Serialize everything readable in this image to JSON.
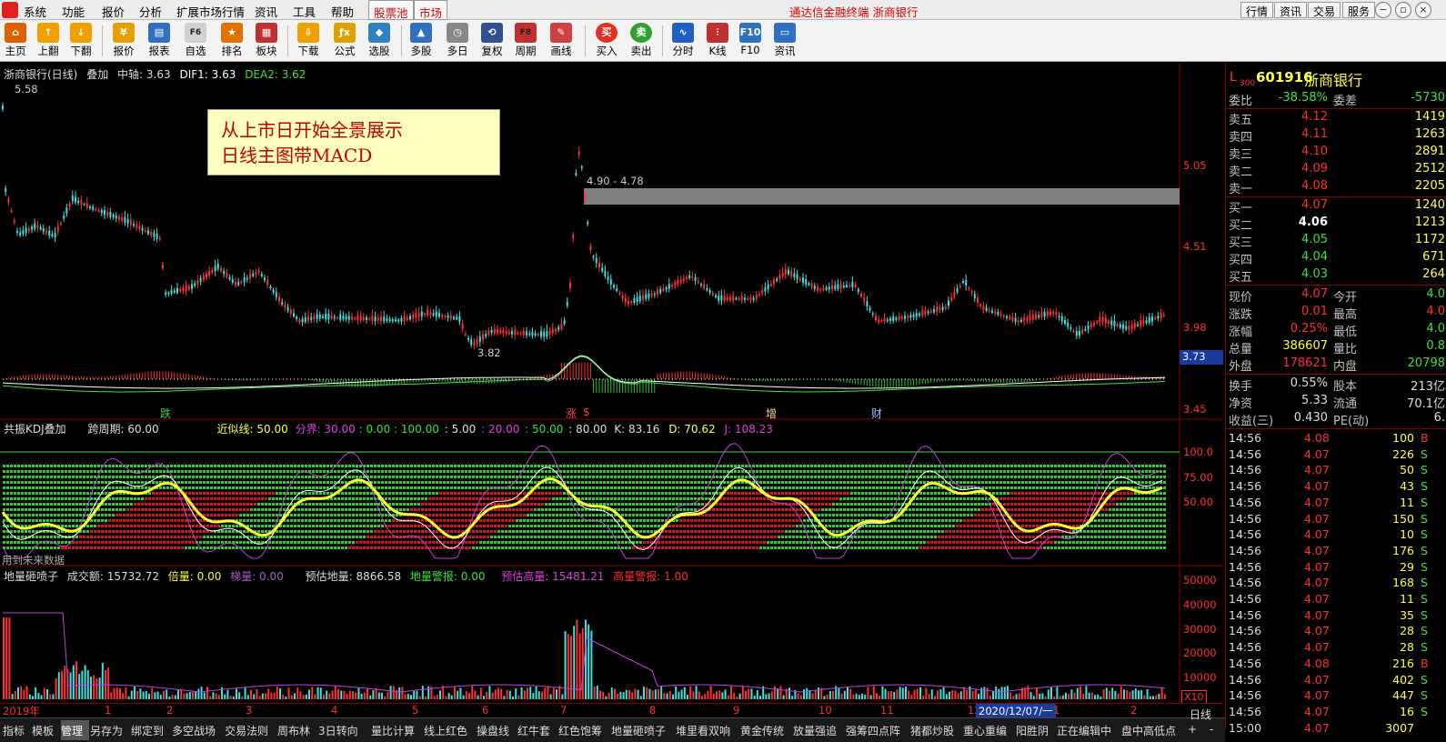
{
  "menubar": {
    "items": [
      "系统",
      "功能",
      "报价",
      "分析",
      "扩展市场行情",
      "资讯",
      "工具",
      "帮助"
    ],
    "tabs": [
      "股票池",
      "市场"
    ],
    "app_title": "通达信金融终端  浙商银行",
    "right_buttons": [
      "行情",
      "资讯",
      "交易",
      "服务"
    ]
  },
  "toolbar": {
    "buttons": [
      {
        "label": "主页",
        "icon": "home-icon",
        "color": "#e06000"
      },
      {
        "label": "上翻",
        "icon": "arrow-up-icon",
        "color": "#f0a000"
      },
      {
        "label": "下翻",
        "icon": "arrow-down-icon",
        "color": "#f0a000"
      },
      {
        "label": "报价",
        "icon": "yen-icon",
        "color": "#e8a000"
      },
      {
        "label": "报表",
        "icon": "report-icon",
        "color": "#3070c0"
      },
      {
        "label": "自选",
        "icon": "f6-icon",
        "color": "#d0d0d0"
      },
      {
        "label": "排名",
        "icon": "rank-icon",
        "color": "#e07000"
      },
      {
        "label": "板块",
        "icon": "blocks-icon",
        "color": "#c03030"
      },
      {
        "label": "下载",
        "icon": "download-icon",
        "color": "#f0a000"
      },
      {
        "label": "公式",
        "icon": "formula-icon",
        "color": "#e0a000"
      },
      {
        "label": "选股",
        "icon": "select-stock-icon",
        "color": "#3080c0"
      },
      {
        "label": "多股",
        "icon": "multi-stock-icon",
        "color": "#3070c0"
      },
      {
        "label": "多日",
        "icon": "clock-icon",
        "color": "#888888"
      },
      {
        "label": "复权",
        "icon": "restore-icon",
        "color": "#305090"
      },
      {
        "label": "周期",
        "icon": "f8-icon",
        "color": "#c03030"
      },
      {
        "label": "画线",
        "icon": "draw-line-icon",
        "color": "#d04040"
      },
      {
        "label": "买入",
        "icon": "buy-icon",
        "color": "#e03020"
      },
      {
        "label": "卖出",
        "icon": "sell-icon",
        "color": "#30a030"
      },
      {
        "label": "分时",
        "icon": "intraday-icon",
        "color": "#2060c0"
      },
      {
        "label": "K线",
        "icon": "kline-icon",
        "color": "#c03030"
      },
      {
        "label": "F10",
        "icon": "f10-icon",
        "color": "#3070c0"
      },
      {
        "label": "资讯",
        "icon": "news-icon",
        "color": "#3070c0"
      }
    ]
  },
  "main_pane": {
    "info": {
      "name": "浙商银行(日线)",
      "overlay": "叠加",
      "mid": "中轴: 3.63",
      "dif": "DIF1: 3.63",
      "dea": "DEA2: 3.62"
    },
    "high_label": "5.58",
    "low_label": "3.82",
    "zone_label": "4.90 - 4.78",
    "overlay_text": [
      "从上市日开始全景展示",
      "日线主图带MACD"
    ],
    "axis": [
      "5.05",
      "4.51",
      "3.98",
      "3.45"
    ],
    "current_price_tag": "3.73",
    "markers": [
      {
        "text": "跌",
        "color": "#40d040"
      },
      {
        "text": "涨",
        "color": "#ff4040"
      },
      {
        "text": "$",
        "color": "#ff4040"
      },
      {
        "text": "增",
        "color": "#ffd0a0"
      },
      {
        "text": "财",
        "color": "#a0c0ff"
      }
    ],
    "colors": {
      "up": "#ff3030",
      "down": "#40e0e0",
      "macd_up": "#ff3030",
      "macd_down": "#30c030"
    }
  },
  "kdj_pane": {
    "info": {
      "name": "共振KDJ叠加",
      "period": "跨周期: 60.00",
      "near": "近似线: 50.00",
      "boundary": "分界: 30.00",
      "v1": ": 0.00",
      "v2": ": 100.00",
      "v3": ": 5.00",
      "v4": ": 20.00",
      "v5": ": 50.00",
      "v6": ": 80.00",
      "k": "K: 83.16",
      "d": "D: 70.62",
      "j": "J: 108.23"
    },
    "axis": [
      "100.0",
      "75.00",
      "50.00"
    ],
    "future_note": "用到未来数据"
  },
  "volume_pane": {
    "info": {
      "name": "地量砸喷子",
      "turnover": "成交额: 15732.72",
      "times": "倍量: 0.00",
      "ladder": "梯量: 0.00",
      "est_low": "预估地量: 8866.58",
      "low_alarm": "地量警报: 0.00",
      "est_high": "预估高量: 15481.21",
      "high_alarm": "高量警报: 1.00"
    },
    "axis": [
      "50000",
      "40000",
      "30000",
      "20000",
      "10000"
    ],
    "unit_tag": "X10"
  },
  "datebar": {
    "labels": [
      "2019年",
      "1",
      "2",
      "3",
      "4",
      "5",
      "6",
      "7",
      "8",
      "9",
      "10",
      "11",
      "12",
      "2020/12/07/一",
      "1",
      "2"
    ]
  },
  "quote": {
    "code": "601916",
    "name": "浙商银行",
    "prefix": "L",
    "sub": "300",
    "weibi_label": "委比",
    "weibi": "-38.58%",
    "weicha_label": "委差",
    "weicha": "-5730",
    "asks": [
      {
        "label": "卖五",
        "price": "4.12",
        "vol": "1419"
      },
      {
        "label": "卖四",
        "price": "4.11",
        "vol": "1263"
      },
      {
        "label": "卖三",
        "price": "4.10",
        "vol": "2891"
      },
      {
        "label": "卖二",
        "price": "4.09",
        "vol": "2512"
      },
      {
        "label": "卖一",
        "price": "4.08",
        "vol": "2205"
      }
    ],
    "bids": [
      {
        "label": "买一",
        "price": "4.07",
        "vol": "1240"
      },
      {
        "label": "买二",
        "price": "4.06",
        "vol": "1213"
      },
      {
        "label": "买三",
        "price": "4.05",
        "vol": "1172"
      },
      {
        "label": "买四",
        "price": "4.04",
        "vol": "671"
      },
      {
        "label": "买五",
        "price": "4.03",
        "vol": "264"
      }
    ],
    "stats": [
      {
        "l1": "现价",
        "v1": "4.07",
        "c1": "#ff3030",
        "l2": "今开",
        "v2": "4.0",
        "c2": "#40e040"
      },
      {
        "l1": "涨跌",
        "v1": "0.01",
        "c1": "#ff3030",
        "l2": "最高",
        "v2": "4.0",
        "c2": "#ff3030"
      },
      {
        "l1": "涨幅",
        "v1": "0.25%",
        "c1": "#ff3030",
        "l2": "最低",
        "v2": "4.0",
        "c2": "#40e040"
      },
      {
        "l1": "总量",
        "v1": "386607",
        "c1": "#ffff40",
        "l2": "量比",
        "v2": "0.8",
        "c2": "#40e040"
      },
      {
        "l1": "外盘",
        "v1": "178621",
        "c1": "#ff3030",
        "l2": "内盘",
        "v2": "20798",
        "c2": "#40e040"
      }
    ],
    "stats2": [
      {
        "l1": "换手",
        "v1": "0.55%",
        "l2": "股本",
        "v2": "213亿"
      },
      {
        "l1": "净资",
        "v1": "5.33",
        "l2": "流通",
        "v2": "70.1亿"
      },
      {
        "l1": "收益(三)",
        "v1": "0.430",
        "l2": "PE(动)",
        "v2": "6."
      }
    ],
    "ticks": [
      {
        "t": "14:56",
        "p": "4.08",
        "pc": "#ff3030",
        "v": "100",
        "s": "B",
        "sc": "#ff3030"
      },
      {
        "t": "14:56",
        "p": "4.07",
        "pc": "#ff3030",
        "v": "226",
        "s": "S",
        "sc": "#40e040"
      },
      {
        "t": "14:56",
        "p": "4.07",
        "pc": "#ff3030",
        "v": "50",
        "s": "S",
        "sc": "#40e040"
      },
      {
        "t": "14:56",
        "p": "4.07",
        "pc": "#ff3030",
        "v": "43",
        "s": "S",
        "sc": "#40e040"
      },
      {
        "t": "14:56",
        "p": "4.07",
        "pc": "#ff3030",
        "v": "11",
        "s": "S",
        "sc": "#40e040"
      },
      {
        "t": "14:56",
        "p": "4.07",
        "pc": "#ff3030",
        "v": "150",
        "s": "S",
        "sc": "#40e040"
      },
      {
        "t": "14:56",
        "p": "4.07",
        "pc": "#ff3030",
        "v": "10",
        "s": "S",
        "sc": "#40e040"
      },
      {
        "t": "14:56",
        "p": "4.07",
        "pc": "#ff3030",
        "v": "176",
        "s": "S",
        "sc": "#40e040"
      },
      {
        "t": "14:56",
        "p": "4.07",
        "pc": "#ff3030",
        "v": "29",
        "s": "S",
        "sc": "#40e040"
      },
      {
        "t": "14:56",
        "p": "4.07",
        "pc": "#ff3030",
        "v": "168",
        "s": "S",
        "sc": "#40e040"
      },
      {
        "t": "14:56",
        "p": "4.07",
        "pc": "#ff3030",
        "v": "11",
        "s": "S",
        "sc": "#40e040"
      },
      {
        "t": "14:56",
        "p": "4.07",
        "pc": "#ff3030",
        "v": "35",
        "s": "S",
        "sc": "#40e040"
      },
      {
        "t": "14:56",
        "p": "4.07",
        "pc": "#ff3030",
        "v": "28",
        "s": "S",
        "sc": "#40e040"
      },
      {
        "t": "14:56",
        "p": "4.07",
        "pc": "#ff3030",
        "v": "28",
        "s": "S",
        "sc": "#40e040"
      },
      {
        "t": "14:56",
        "p": "4.08",
        "pc": "#ff3030",
        "v": "216",
        "s": "B",
        "sc": "#ff3030"
      },
      {
        "t": "14:56",
        "p": "4.07",
        "pc": "#ff3030",
        "v": "402",
        "s": "S",
        "sc": "#40e040"
      },
      {
        "t": "14:56",
        "p": "4.07",
        "pc": "#ff3030",
        "v": "447",
        "s": "S",
        "sc": "#40e040"
      },
      {
        "t": "14:56",
        "p": "4.07",
        "pc": "#ff3030",
        "v": "16",
        "s": "S",
        "sc": "#40e040"
      },
      {
        "t": "15:00",
        "p": "4.07",
        "pc": "#ff3030",
        "v": "3007",
        "s": "",
        "sc": "#40e040"
      }
    ]
  },
  "tabbar": {
    "tabs": [
      "指标",
      "模板",
      "管理",
      "另存为",
      "绑定到",
      "多空战场",
      "交易法则",
      "周布林",
      "3日转向",
      "量比计算",
      "线上红色",
      "操盘线",
      "红牛套",
      "红色饱筹",
      "地量砸喷子",
      "堆里看双响",
      "黄金传统",
      "放量强追",
      "强筹四点阵",
      "猪都炒股",
      "重心重编",
      "阳胜阴",
      "正在编辑中",
      "盘中高低点"
    ],
    "active": "管理",
    "right_tabs": [
      "日线",
      "+",
      "-"
    ]
  }
}
